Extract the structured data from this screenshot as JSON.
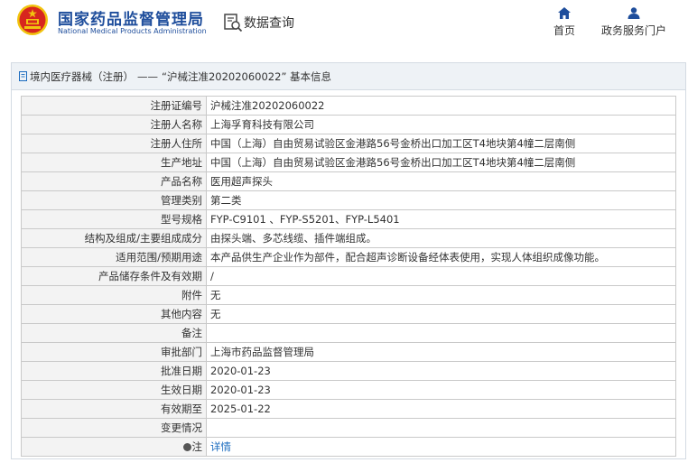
{
  "header": {
    "site_name_cn": "国家药品监督管理局",
    "site_name_en": "National Medical Products Administration",
    "query_label": "数据查询",
    "nav": [
      {
        "label": "首页",
        "icon": "home-icon"
      },
      {
        "label": "政务服务门户",
        "icon": "user-icon"
      }
    ]
  },
  "colors": {
    "brand_blue": "#1f4e9c",
    "emblem_red": "#d7261e",
    "emblem_gold": "#f1c40f",
    "link_blue": "#1a6bbf"
  },
  "breadcrumb": {
    "category": "境内医疗器械（注册）",
    "separator": "——",
    "title": "“沪械注准20202060022” 基本信息"
  },
  "rows": [
    {
      "key": "注册证编号",
      "value": "沪械注准20202060022"
    },
    {
      "key": "注册人名称",
      "value": "上海孚育科技有限公司"
    },
    {
      "key": "注册人住所",
      "value": "中国（上海）自由贸易试验区金港路56号金桥出口加工区T4地块第4幢二层南侧"
    },
    {
      "key": "生产地址",
      "value": "中国（上海）自由贸易试验区金港路56号金桥出口加工区T4地块第4幢二层南侧"
    },
    {
      "key": "产品名称",
      "value": "医用超声探头"
    },
    {
      "key": "管理类别",
      "value": "第二类"
    },
    {
      "key": "型号规格",
      "value": "FYP-C9101 、FYP-S5201、FYP-L5401"
    },
    {
      "key": "结构及组成/主要组成成分",
      "value": "由探头端、多芯线缆、插件端组成。"
    },
    {
      "key": "适用范围/预期用途",
      "value": "本产品供生产企业作为部件，配合超声诊断设备经体表使用，实现人体组织成像功能。"
    },
    {
      "key": "产品储存条件及有效期",
      "value": "/"
    },
    {
      "key": "附件",
      "value": "无"
    },
    {
      "key": "其他内容",
      "value": "无"
    },
    {
      "key": "备注",
      "value": ""
    },
    {
      "key": "审批部门",
      "value": "上海市药品监督管理局"
    },
    {
      "key": "批准日期",
      "value": "2020-01-23"
    },
    {
      "key": "生效日期",
      "value": "2020-01-23"
    },
    {
      "key": "有效期至",
      "value": "2025-01-22"
    },
    {
      "key": "变更情况",
      "value": ""
    }
  ],
  "note_row": {
    "key": "注",
    "icon": "note-icon",
    "link_label": "详情"
  }
}
